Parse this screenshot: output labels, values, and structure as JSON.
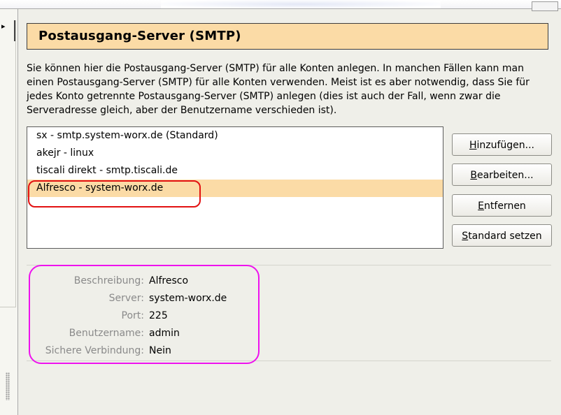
{
  "header": {
    "title": "Postausgang-Server (SMTP)"
  },
  "description": "Sie können hier die Postausgang-Server (SMTP) für alle Konten anlegen. In manchen Fällen kann man einen Postausgang-Server (SMTP) für alle Konten verwenden. Meist ist es aber notwendig, dass Sie für jedes Konto getrennte Postausgang-Server (SMTP) anlegen (dies ist auch der Fall, wenn zwar die Serveradresse gleich, aber der Benutzername verschieden ist).",
  "server_list": {
    "items": [
      {
        "label": "sx - smtp.system-worx.de (Standard)"
      },
      {
        "label": "akejr - linux"
      },
      {
        "label": "tiscali direkt - smtp.tiscali.de"
      },
      {
        "label": "Alfresco - system-worx.de",
        "selected": true
      }
    ]
  },
  "buttons": {
    "add": {
      "accel": "H",
      "rest": "inzufügen..."
    },
    "edit": {
      "accel": "B",
      "rest": "earbeiten..."
    },
    "remove": {
      "accel": "E",
      "rest": "ntfernen"
    },
    "default": {
      "accel": "S",
      "rest": "tandard setzen"
    }
  },
  "details": {
    "description_label": "Beschreibung:",
    "description_value": "Alfresco",
    "server_label": "Server:",
    "server_value": "system-worx.de",
    "port_label": "Port:",
    "port_value": "225",
    "username_label": "Benutzername:",
    "username_value": "admin",
    "secure_label": "Sichere Verbindung:",
    "secure_value": "Nein"
  },
  "colors": {
    "title_background": "#fbdba6",
    "selection": "#fbdba6",
    "annotation_red": "#e21111",
    "annotation_magenta": "#ee12ee"
  }
}
